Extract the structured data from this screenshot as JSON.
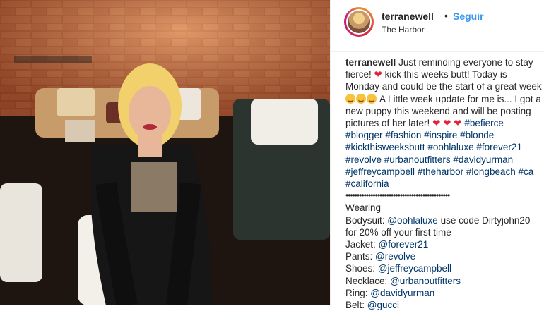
{
  "post": {
    "username": "terranewell",
    "follow_label": "Seguir",
    "location": "The Harbor"
  },
  "caption": {
    "username": "terranewell",
    "part1": "Just reminding everyone to stay fierce!",
    "part2": "kick this weeks butt! Today is Monday and could be the start of a great week",
    "part3": "A Little week update for me is... I got a new puppy this weekend and will be posting pictures of her later!",
    "hashtags": [
      "#befierce",
      "#blogger",
      "#fashion",
      "#inspire",
      "#blonde",
      "#kickthisweeksbutt",
      "#oohlaluxe",
      "#forever21",
      "#revolve",
      "#urbanoutfitters",
      "#davidyurman",
      "#jeffreycampbell",
      "#theharbor",
      "#longbeach",
      "#ca",
      "#california"
    ],
    "divider": "••••••••••••••••••••••••••••••••••••••••••••••",
    "wearing_label": "Wearing",
    "bodysuit_label": "Bodysuit:",
    "bodysuit_handle": "@oohlaluxe",
    "bodysuit_note": "use code Dirtyjohn20 for 20% off your first time",
    "jacket_label": "Jacket:",
    "jacket_handle": "@forever21",
    "pants_label": "Pants:",
    "pants_handle": "@revolve",
    "shoes_label": "Shoes:",
    "shoes_handle": "@jeffreycampbell",
    "necklace_label": "Necklace:",
    "necklace_handle": "@urbanoutfitters",
    "ring_label": "Ring:",
    "ring_handle": "@davidyurman",
    "belt_label": "Belt:",
    "belt_handle": "@gucci"
  },
  "icons": {
    "heart": "red-heart-icon",
    "smile": "smiling-face-icon"
  },
  "colors": {
    "link": "#003569",
    "follow": "#3897f0",
    "heart": "#e2243b"
  }
}
